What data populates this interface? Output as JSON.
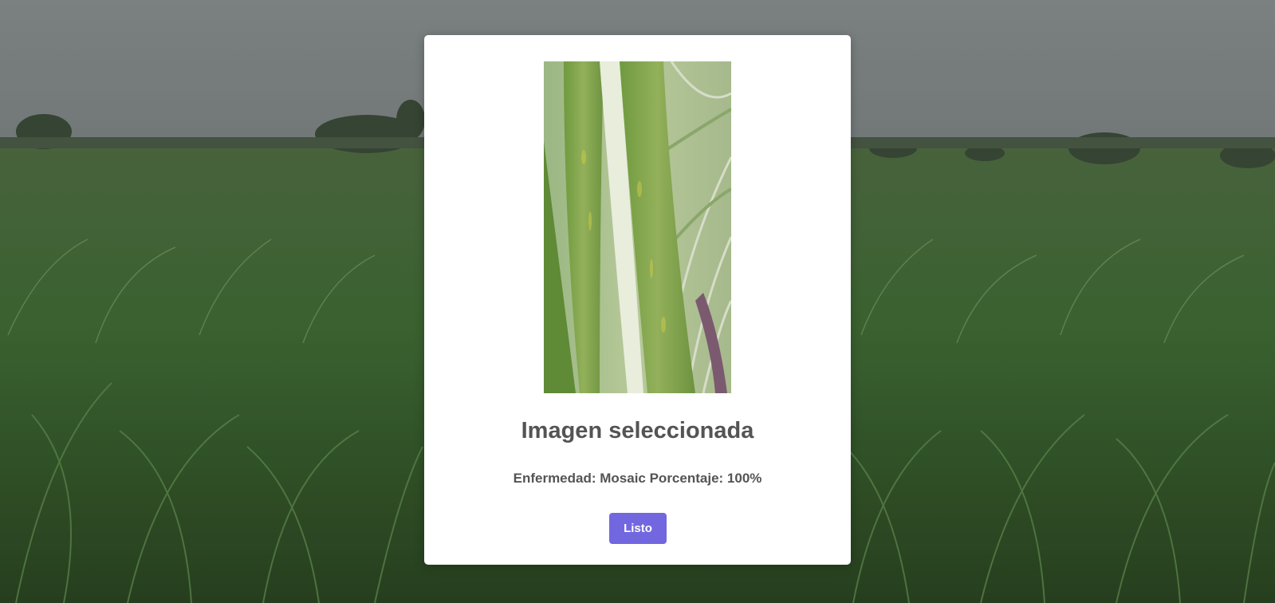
{
  "modal": {
    "title": "Imagen seleccionada",
    "result_text": "Enfermedad: Mosaic Porcentaje: 100%",
    "confirm_label": "Listo"
  },
  "colors": {
    "button": "#7367e0",
    "text": "#545454",
    "card": "#ffffff"
  }
}
